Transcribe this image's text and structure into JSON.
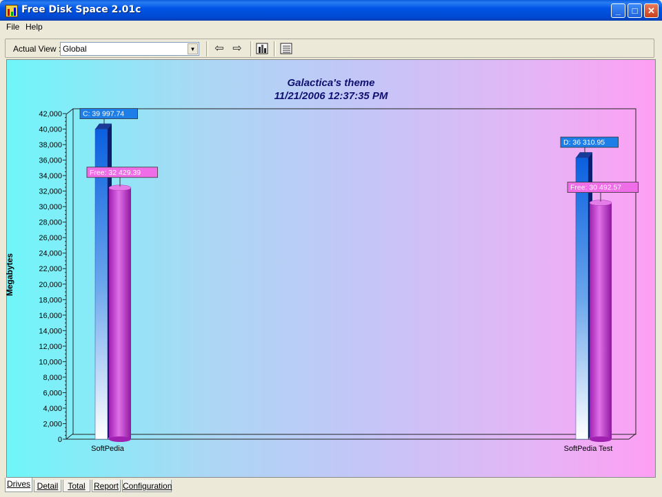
{
  "window": {
    "title": "Free Disk Space 2.01c"
  },
  "menu": {
    "items": [
      "File",
      "Help"
    ]
  },
  "toolbar": {
    "view_label": "Actual View :",
    "view_value": "Global"
  },
  "tabs": [
    "Drives",
    "Detail",
    "Total",
    "Report",
    "Configuration"
  ],
  "active_tab": "Drives",
  "chart_data": {
    "type": "bar",
    "title": "Galactica's theme",
    "subtitle": "11/21/2006 12:37:35 PM",
    "ylabel": "Megabytes",
    "xlabel": "",
    "ylim": [
      0,
      42000
    ],
    "yticks": [
      "0",
      "2,000",
      "4,000",
      "6,000",
      "8,000",
      "10,000",
      "12,000",
      "14,000",
      "16,000",
      "18,000",
      "20,000",
      "22,000",
      "24,000",
      "26,000",
      "28,000",
      "30,000",
      "32,000",
      "34,000",
      "36,000",
      "38,000",
      "40,000",
      "42,000"
    ],
    "categories": [
      "SoftPedia",
      "SoftPedia Test"
    ],
    "series": [
      {
        "name": "",
        "values": [
          39997.74,
          36310.95
        ],
        "labels": [
          "C: 39 997.74",
          "D: 36 310.95"
        ],
        "color": "#1e6fe0"
      },
      {
        "name": "Free",
        "values": [
          32429.39,
          30492.57
        ],
        "labels": [
          "Free: 32 429.39",
          "Free: 30 492.57"
        ],
        "color": "#c040c8"
      }
    ],
    "grid": false
  }
}
